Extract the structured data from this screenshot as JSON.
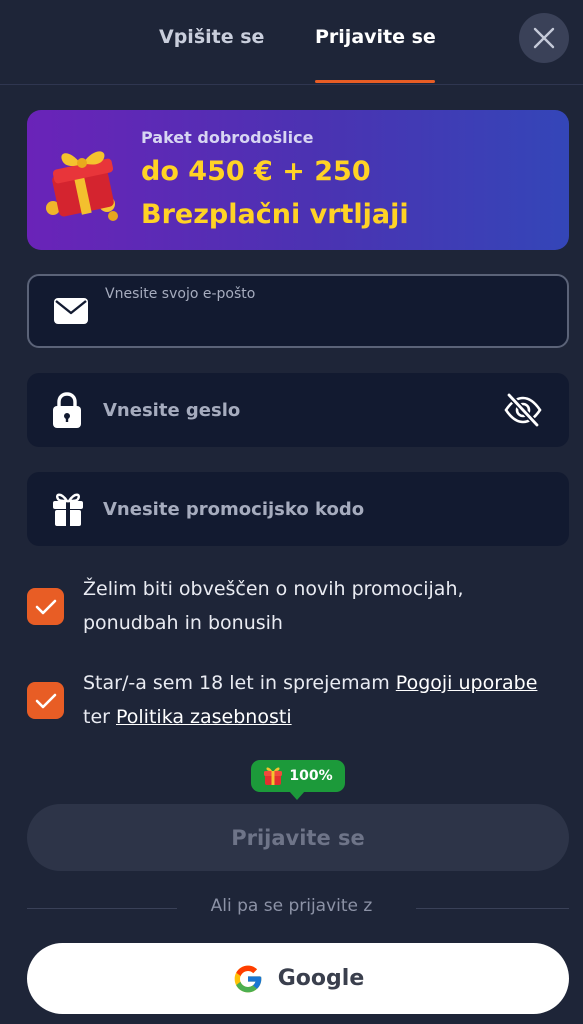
{
  "tabs": {
    "register": "Vpišite se",
    "login": "Prijavite se"
  },
  "banner": {
    "subtitle": "Paket dobrodošlice",
    "line1": "do 450 € + 250",
    "line2": "Brezplačni vrtljaji"
  },
  "form": {
    "email_label": "Vnesite svojo e-pošto",
    "email_value": "",
    "password_placeholder": "Vnesite geslo",
    "promo_placeholder": "Vnesite promocijsko kodo"
  },
  "checkboxes": {
    "promo_text": "Želim biti obveščen o novih promocijah, ponudbah in bonusih",
    "promo_checked": true,
    "terms_prefix": "Star/-a sem 18 let in sprejemam ",
    "terms_link": "Pogoji uporabe",
    "terms_middle": " ter ",
    "privacy_link": "Politika zasebnosti",
    "terms_checked": true
  },
  "bonus_badge": "100%",
  "submit_label": "Prijavite se",
  "divider_text": "Ali pa se prijavite z",
  "google_label": "Google",
  "colors": {
    "background": "#1e2538",
    "accent": "#e85d25",
    "highlight": "#ffd325",
    "badge": "#1c9a3a"
  }
}
